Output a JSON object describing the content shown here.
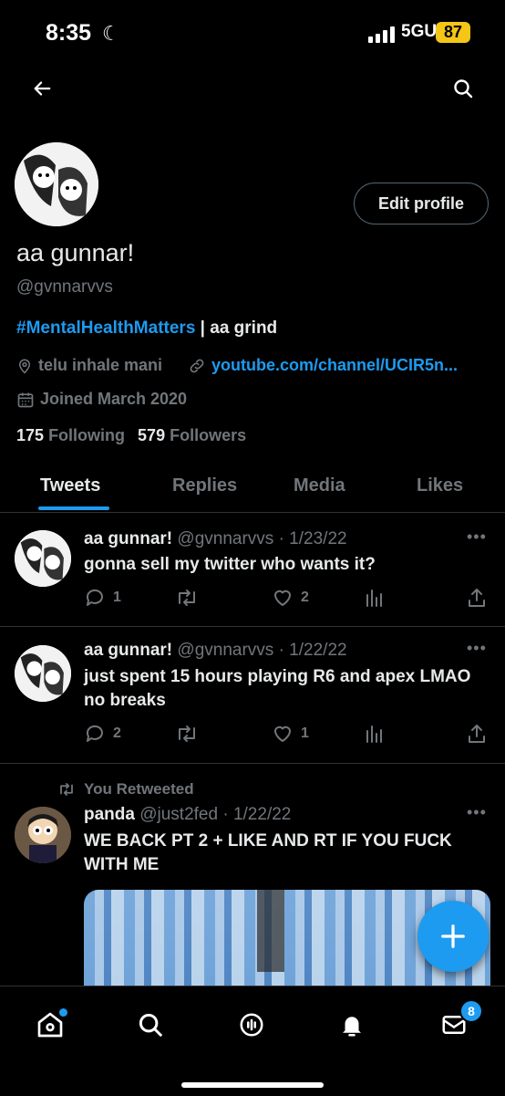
{
  "status_bar": {
    "time": "8:35",
    "network": "5GUC",
    "battery": "87"
  },
  "profile": {
    "display_name": "aa gunnar!",
    "handle": "@gvnnarvvs",
    "edit_button": "Edit profile",
    "bio_hashtag": "#MentalHealthMatters",
    "bio_rest": " | aa grind",
    "location": "telu inhale mani",
    "website": "youtube.com/channel/UCIR5n...",
    "joined": "Joined March 2020",
    "following_count": "175",
    "following_label": "Following",
    "followers_count": "579",
    "followers_label": "Followers"
  },
  "tabs": [
    "Tweets",
    "Replies",
    "Media",
    "Likes"
  ],
  "tweets": [
    {
      "name": "aa gunnar!",
      "handle": "@gvnnarvvs",
      "date": "· 1/23/22",
      "text": "gonna sell my twitter who wants it?",
      "replies": "1",
      "retweets": "",
      "likes": "2"
    },
    {
      "name": "aa gunnar!",
      "handle": "@gvnnarvvs",
      "date": "· 1/22/22",
      "text": "just spent 15 hours playing R6 and apex LMAO no breaks",
      "replies": "2",
      "retweets": "",
      "likes": "1"
    },
    {
      "retweet_label": "You Retweeted",
      "name": "panda",
      "handle": "@just2fed",
      "date": "· 1/22/22",
      "text": "WE BACK PT 2 + LIKE AND RT IF YOU FUCK WITH ME"
    }
  ],
  "nav": {
    "messages_badge": "8"
  },
  "colors": {
    "accent": "#1d9bf0",
    "background": "#000000",
    "muted": "#71767b"
  }
}
